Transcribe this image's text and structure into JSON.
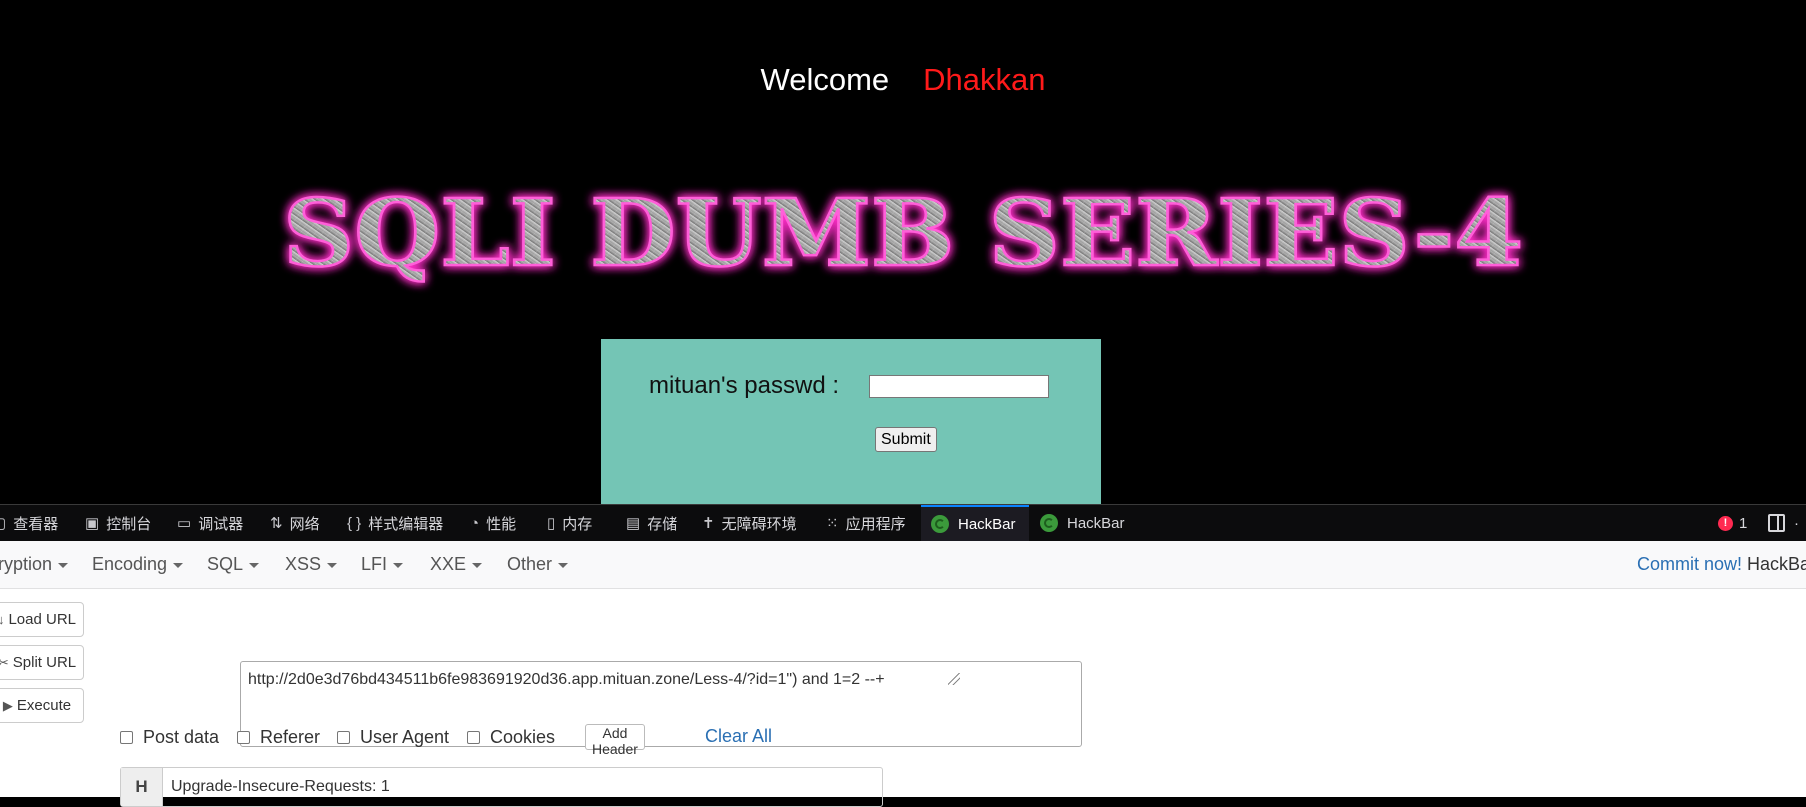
{
  "page": {
    "welcome": "Welcome",
    "user": "Dhakkan",
    "banner": "SQLI DUMB SERIES-4",
    "form": {
      "password_label": "mituan's passwd :",
      "password_value": "",
      "submit_label": "Submit"
    }
  },
  "devtools": {
    "tabs": [
      {
        "label": "查看器",
        "icon": "inspector-icon"
      },
      {
        "label": "控制台",
        "icon": "console-icon"
      },
      {
        "label": "调试器",
        "icon": "debugger-icon"
      },
      {
        "label": "网络",
        "icon": "network-icon"
      },
      {
        "label": "样式编辑器",
        "icon": "style-editor-icon"
      },
      {
        "label": "性能",
        "icon": "performance-icon"
      },
      {
        "label": "内存",
        "icon": "memory-icon"
      },
      {
        "label": "存储",
        "icon": "storage-icon"
      },
      {
        "label": "无障碍环境",
        "icon": "accessibility-icon"
      },
      {
        "label": "应用程序",
        "icon": "application-icon"
      },
      {
        "label": "HackBar",
        "icon": "hackbar-icon",
        "active": true
      },
      {
        "label": "HackBar",
        "icon": "hackbar-icon"
      }
    ],
    "error_count": "1"
  },
  "hackbar": {
    "menu": [
      "ryption",
      "Encoding",
      "SQL",
      "XSS",
      "LFI",
      "XXE",
      "Other"
    ],
    "commit_link": "Commit now!",
    "brand": "HackBa",
    "buttons": {
      "load_url": "Load URL",
      "split_url": "Split URL",
      "execute": "Execute"
    },
    "url": "http://2d0e3d76bd434511b6fe983691920d36.app.mituan.zone/Less-4/?id=1\") and 1=2 --+",
    "options": {
      "post_data": "Post data",
      "referer": "Referer",
      "user_agent": "User Agent",
      "cookies": "Cookies",
      "add_header": "Add Header",
      "clear_all": "Clear All"
    },
    "header": {
      "key": "H",
      "value": "Upgrade-Insecure-Requests: 1"
    }
  },
  "colors": {
    "welcome_name": "#ff1a1a",
    "form_bg": "#74c5b5",
    "banner_glow": "#ff2fc8",
    "active_tab_accent": "#0a84ff",
    "link": "#2a6fb3"
  }
}
